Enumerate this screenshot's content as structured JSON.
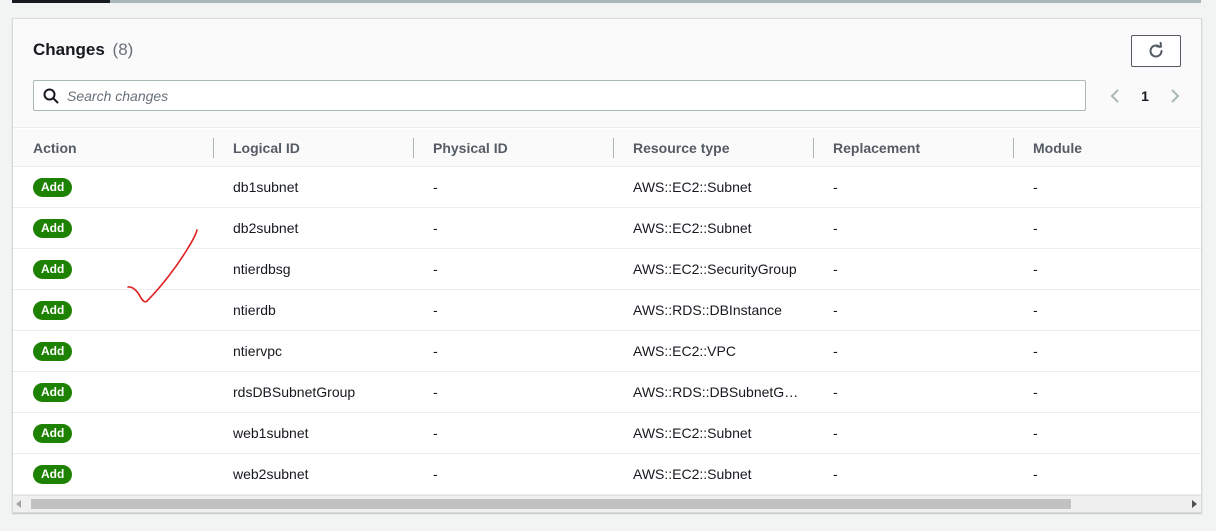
{
  "header": {
    "title": "Changes",
    "count": "(8)",
    "search_placeholder": "Search changes",
    "page_number": "1"
  },
  "columns": [
    "Action",
    "Logical ID",
    "Physical ID",
    "Resource type",
    "Replacement",
    "Module"
  ],
  "rows": [
    {
      "action": "Add",
      "logical_id": "db1subnet",
      "physical_id": "-",
      "resource_type": "AWS::EC2::Subnet",
      "replacement": "-",
      "module": "-"
    },
    {
      "action": "Add",
      "logical_id": "db2subnet",
      "physical_id": "-",
      "resource_type": "AWS::EC2::Subnet",
      "replacement": "-",
      "module": "-"
    },
    {
      "action": "Add",
      "logical_id": "ntierdbsg",
      "physical_id": "-",
      "resource_type": "AWS::EC2::SecurityGroup",
      "replacement": "-",
      "module": "-"
    },
    {
      "action": "Add",
      "logical_id": "ntierdb",
      "physical_id": "-",
      "resource_type": "AWS::RDS::DBInstance",
      "replacement": "-",
      "module": "-"
    },
    {
      "action": "Add",
      "logical_id": "ntiervpc",
      "physical_id": "-",
      "resource_type": "AWS::EC2::VPC",
      "replacement": "-",
      "module": "-"
    },
    {
      "action": "Add",
      "logical_id": "rdsDBSubnetGroup",
      "physical_id": "-",
      "resource_type": "AWS::RDS::DBSubnetG…",
      "replacement": "-",
      "module": "-"
    },
    {
      "action": "Add",
      "logical_id": "web1subnet",
      "physical_id": "-",
      "resource_type": "AWS::EC2::Subnet",
      "replacement": "-",
      "module": "-"
    },
    {
      "action": "Add",
      "logical_id": "web2subnet",
      "physical_id": "-",
      "resource_type": "AWS::EC2::Subnet",
      "replacement": "-",
      "module": "-"
    }
  ],
  "icons": {
    "refresh": "refresh-icon",
    "search": "search-icon",
    "prev": "chevron-left-icon",
    "next": "chevron-right-icon"
  },
  "colors": {
    "add_badge": "#1d8102",
    "annotation": "#e02020"
  }
}
